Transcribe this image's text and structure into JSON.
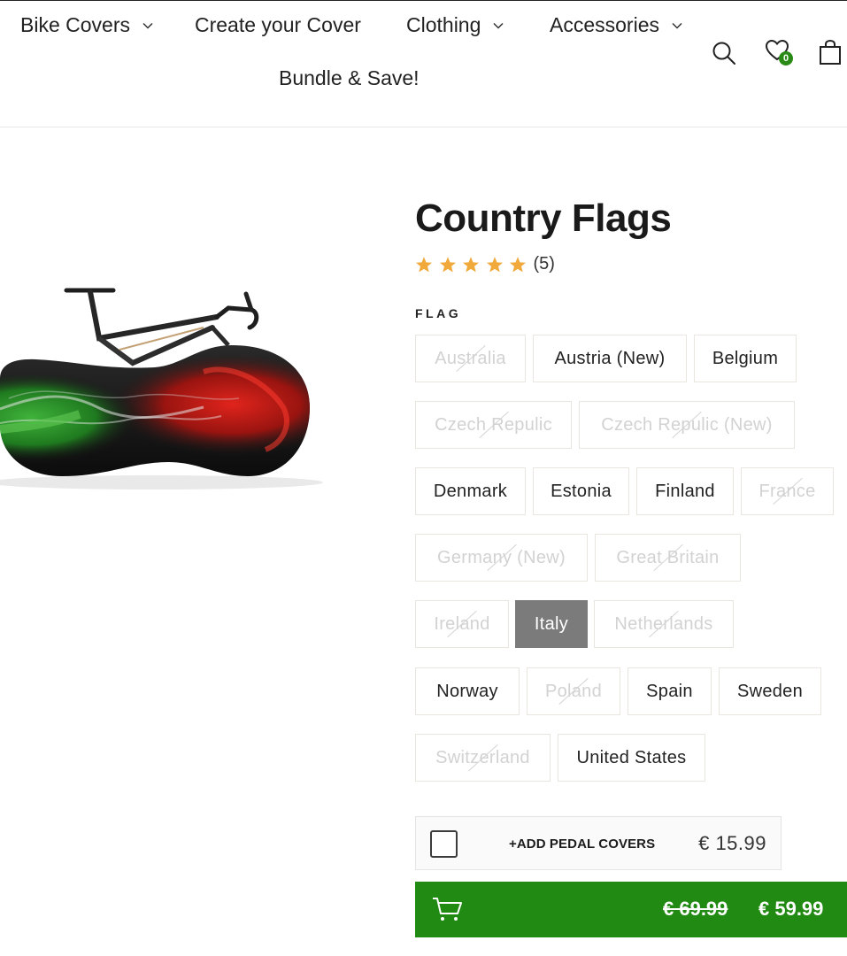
{
  "nav": {
    "items": [
      {
        "label": "Bike Covers",
        "has_dropdown": true
      },
      {
        "label": "Create your Cover",
        "has_dropdown": false
      },
      {
        "label": "Clothing",
        "has_dropdown": true
      },
      {
        "label": "Accessories",
        "has_dropdown": true
      },
      {
        "label": "Bundle & Save!",
        "has_dropdown": false
      }
    ],
    "icons": [
      "search-icon",
      "wishlist-heart-icon",
      "cart-bag-icon"
    ],
    "wishlist_count": "0"
  },
  "product": {
    "title": "Country Flags",
    "rating": 5,
    "review_count": "(5)",
    "option_label": "FLAG",
    "options": [
      {
        "label": "Australia",
        "available": false
      },
      {
        "label": "Austria (New)",
        "available": true
      },
      {
        "label": "Belgium",
        "available": true
      },
      {
        "label": "Czech Repulic",
        "available": false
      },
      {
        "label": "Czech Repulic (New)",
        "available": false
      },
      {
        "label": "Denmark",
        "available": true
      },
      {
        "label": "Estonia",
        "available": true
      },
      {
        "label": "Finland",
        "available": true
      },
      {
        "label": "France",
        "available": false
      },
      {
        "label": "Germany (New)",
        "available": false
      },
      {
        "label": "Great Britain",
        "available": false
      },
      {
        "label": "Ireland",
        "available": false
      },
      {
        "label": "Italy",
        "available": true,
        "selected": true
      },
      {
        "label": "Netherlands",
        "available": false
      },
      {
        "label": "Norway",
        "available": true
      },
      {
        "label": "Poland",
        "available": false
      },
      {
        "label": "Spain",
        "available": true
      },
      {
        "label": "Sweden",
        "available": true
      },
      {
        "label": "Switzerland",
        "available": false
      },
      {
        "label": "United States",
        "available": true
      }
    ],
    "addon": {
      "label": "+ADD PEDAL COVERS",
      "price": "€ 15.99",
      "checked": false
    },
    "cart": {
      "old_price": "€ 69.99",
      "new_price": "€ 59.99"
    }
  },
  "colors": {
    "accent_green": "#218a13",
    "star": "#f0a93a",
    "selected_option": "#7b7b7b"
  }
}
